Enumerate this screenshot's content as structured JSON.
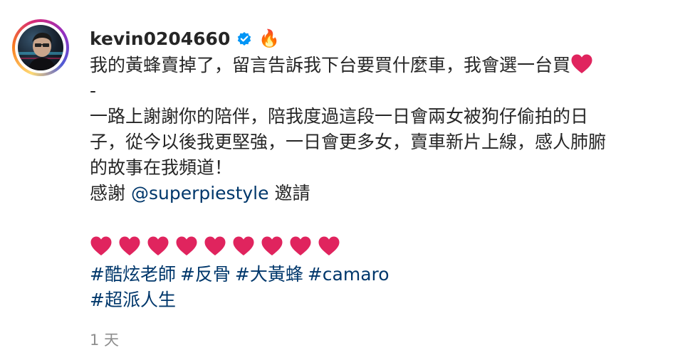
{
  "post": {
    "username": "kevin0204660",
    "verified_icon": "verified-badge-icon",
    "fire_emoji": "🔥",
    "caption_lines": [
      "我的黃蜂賣掉了，留言告訴我下台要買什麼車，我會選一台買",
      "-",
      "一路上謝謝你的陪伴，陪我度過這段一日會兩女被狗仔偷拍的日",
      "子，從今以後我更堅強，一日會更多女，賣車新片上線，感人肺腑",
      "的故事在我頻道！"
    ],
    "thanks_prefix": "感謝 ",
    "mention": "@superpiestyle",
    "thanks_suffix": " 邀請",
    "heart_count": 9,
    "hashtags_line1": [
      "#酷炫老師",
      "#反骨",
      "#大黃蜂",
      "#camaro"
    ],
    "hashtags_line2": [
      "#超派人生"
    ],
    "timestamp": "1 天"
  },
  "colors": {
    "text": "#262626",
    "link": "#00376b",
    "muted": "#8e8e8e",
    "verified": "#0095f6",
    "heart": "#e0245e"
  }
}
